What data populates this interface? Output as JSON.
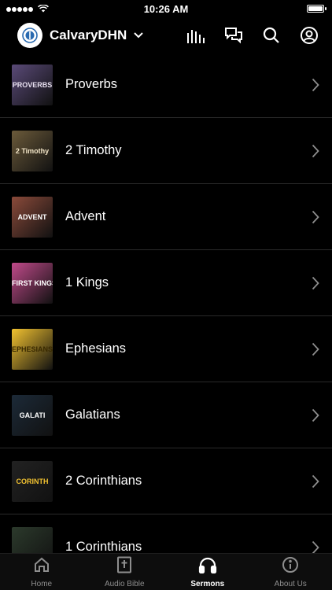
{
  "status_bar": {
    "time": "10:26 AM",
    "battery_level": 1.0
  },
  "header": {
    "app_name": "CalvaryDHN"
  },
  "sermon_series": [
    {
      "title": "Proverbs",
      "thumb_text": "PROVERBS",
      "thumb_bg": "#5a4a78",
      "thumb_fg": "#e8e0f0"
    },
    {
      "title": "2 Timothy",
      "thumb_text": "2 Timothy",
      "thumb_bg": "#6b5a3a",
      "thumb_fg": "#f3e6c8"
    },
    {
      "title": "Advent",
      "thumb_text": "ADVENT",
      "thumb_bg": "#8a4a3a",
      "thumb_fg": "#ffffff"
    },
    {
      "title": "1 Kings",
      "thumb_text": "FIRST KINGS",
      "thumb_bg": "#c04a8a",
      "thumb_fg": "#ffffff"
    },
    {
      "title": "Ephesians",
      "thumb_text": "EPHESIANS",
      "thumb_bg": "#f2c230",
      "thumb_fg": "#3a2a00"
    },
    {
      "title": "Galatians",
      "thumb_text": "GALATI",
      "thumb_bg": "#1c2a38",
      "thumb_fg": "#ffffff"
    },
    {
      "title": "2 Corinthians",
      "thumb_text": "CORINTH",
      "thumb_bg": "#222222",
      "thumb_fg": "#f2c230"
    },
    {
      "title": "1 Corinthians",
      "thumb_text": "",
      "thumb_bg": "#2c3a2c",
      "thumb_fg": "#9fd2a0"
    }
  ],
  "tabbar": [
    {
      "label": "Home",
      "icon": "home-icon",
      "active": false
    },
    {
      "label": "Audio Bible",
      "icon": "bible-icon",
      "active": false
    },
    {
      "label": "Sermons",
      "icon": "headphones-icon",
      "active": true
    },
    {
      "label": "About Us",
      "icon": "info-icon",
      "active": false
    }
  ],
  "colors": {
    "background": "#000000",
    "divider": "#2a2a2a",
    "inactive_tab": "#8e8e8e"
  }
}
